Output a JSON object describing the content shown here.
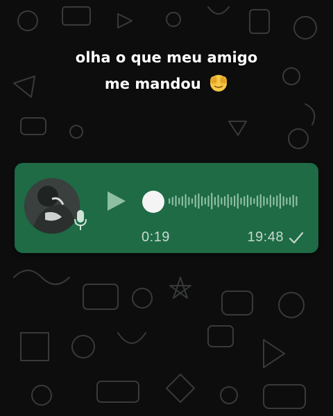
{
  "caption": {
    "line1": "olha o que meu amigo",
    "line2": "me mandou",
    "emoji": "face-with-hand-over-eyes"
  },
  "voice_message": {
    "duration": "0:19",
    "time": "19:48",
    "status_icon": "single-check-icon",
    "progress": 0,
    "play_icon": "play-icon",
    "mic_icon": "mic-icon"
  },
  "colors": {
    "bubble": "#1e6b46",
    "background": "#0d0d0e",
    "meta_text": "#c9d8cf",
    "knob": "#f4f4f4",
    "caption_text": "#ffffff"
  }
}
